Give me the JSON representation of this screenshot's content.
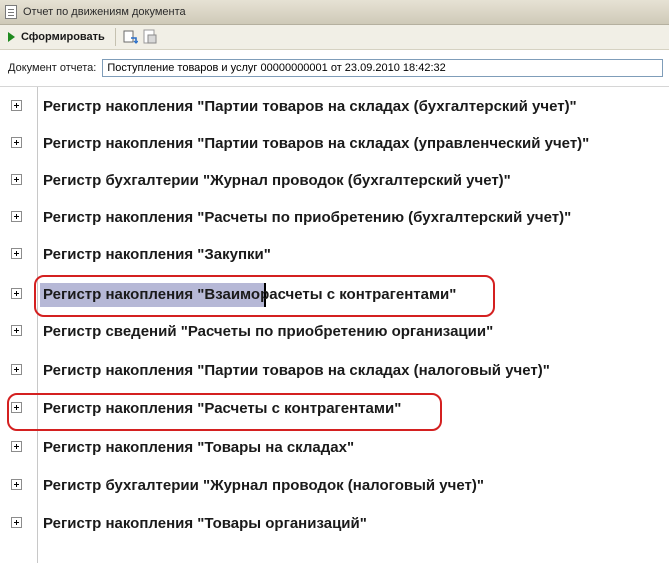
{
  "window": {
    "title": "Отчет по движениям документа"
  },
  "toolbar": {
    "generate_label": "Сформировать"
  },
  "document": {
    "label": "Документ отчета:",
    "value": "Поступление товаров и услуг 00000000001 от 23.09.2010 18:42:32"
  },
  "tree": {
    "rows": [
      {
        "label": "Регистр накопления \"Партии товаров на складах (бухгалтерский учет)\""
      },
      {
        "label": "Регистр накопления \"Партии товаров на складах (управленческий учет)\""
      },
      {
        "label": "Регистр бухгалтерии \"Журнал проводок (бухгалтерский учет)\""
      },
      {
        "label": "Регистр накопления \"Расчеты по приобретению (бухгалтерский учет)\""
      },
      {
        "label": "Регистр накопления \"Закупки\""
      },
      {
        "label": "Регистр накопления \"Взаиморасчеты с контрагентами\""
      },
      {
        "label": "Регистр сведений \"Расчеты по приобретению организации\""
      },
      {
        "label": "Регистр накопления \"Партии товаров на складах (налоговый учет)\""
      },
      {
        "label": "Регистр накопления \"Расчеты с контрагентами\""
      },
      {
        "label": "Регистр накопления \"Товары на складах\""
      },
      {
        "label": "Регистр бухгалтерии \"Журнал проводок (налоговый учет)\""
      },
      {
        "label": "Регистр накопления \"Товары организаций\""
      }
    ]
  },
  "colors": {
    "highlight": "#b6b8d6",
    "annotation_outline": "#d42020",
    "play_icon": "#1f8a1f"
  }
}
